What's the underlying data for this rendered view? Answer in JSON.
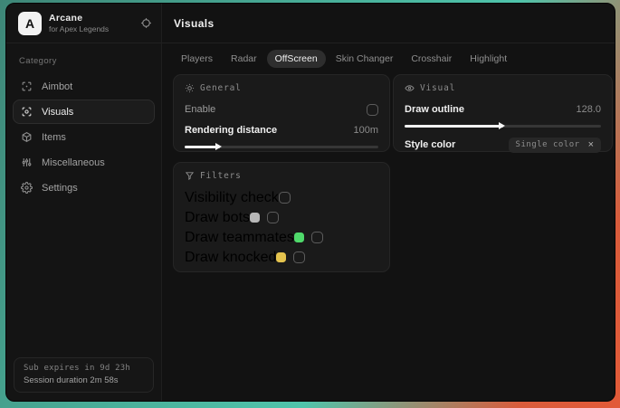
{
  "app": {
    "logo_letter": "A",
    "name": "Arcane",
    "subtitle": "for Apex Legends"
  },
  "sidebar": {
    "category_label": "Category",
    "items": [
      {
        "label": "Aimbot",
        "active": false
      },
      {
        "label": "Visuals",
        "active": true
      },
      {
        "label": "Items",
        "active": false
      },
      {
        "label": "Miscellaneous",
        "active": false
      },
      {
        "label": "Settings",
        "active": false
      }
    ],
    "status": {
      "sub_expires": "Sub expires in 9d 23h",
      "session_duration": "Session duration 2m 58s"
    }
  },
  "main": {
    "title": "Visuals",
    "tabs": [
      {
        "label": "Players",
        "active": false
      },
      {
        "label": "Radar",
        "active": false
      },
      {
        "label": "OffScreen",
        "active": true
      },
      {
        "label": "Skin Changer",
        "active": false
      },
      {
        "label": "Crosshair",
        "active": false
      },
      {
        "label": "Highlight",
        "active": false
      }
    ],
    "panels": {
      "general": {
        "title": "General",
        "enable": {
          "label": "Enable",
          "checked": false
        },
        "rendering_distance": {
          "label": "Rendering distance",
          "value": "100m",
          "percent": 18
        }
      },
      "visual": {
        "title": "Visual",
        "draw_outline": {
          "label": "Draw outline",
          "value": "128.0",
          "percent": 50
        },
        "style_color": {
          "label": "Style color",
          "selected": "Single color",
          "close_glyph": "×"
        }
      },
      "filters": {
        "title": "Filters",
        "rows": [
          {
            "label": "Visibility check",
            "swatch": null,
            "checked": false
          },
          {
            "label": "Draw bots",
            "swatch": "#b8b8b8",
            "checked": false
          },
          {
            "label": "Draw teammates",
            "swatch": "#4fd96b",
            "checked": false
          },
          {
            "label": "Draw knocked",
            "swatch": "#e4c34e",
            "checked": false
          }
        ]
      }
    }
  }
}
